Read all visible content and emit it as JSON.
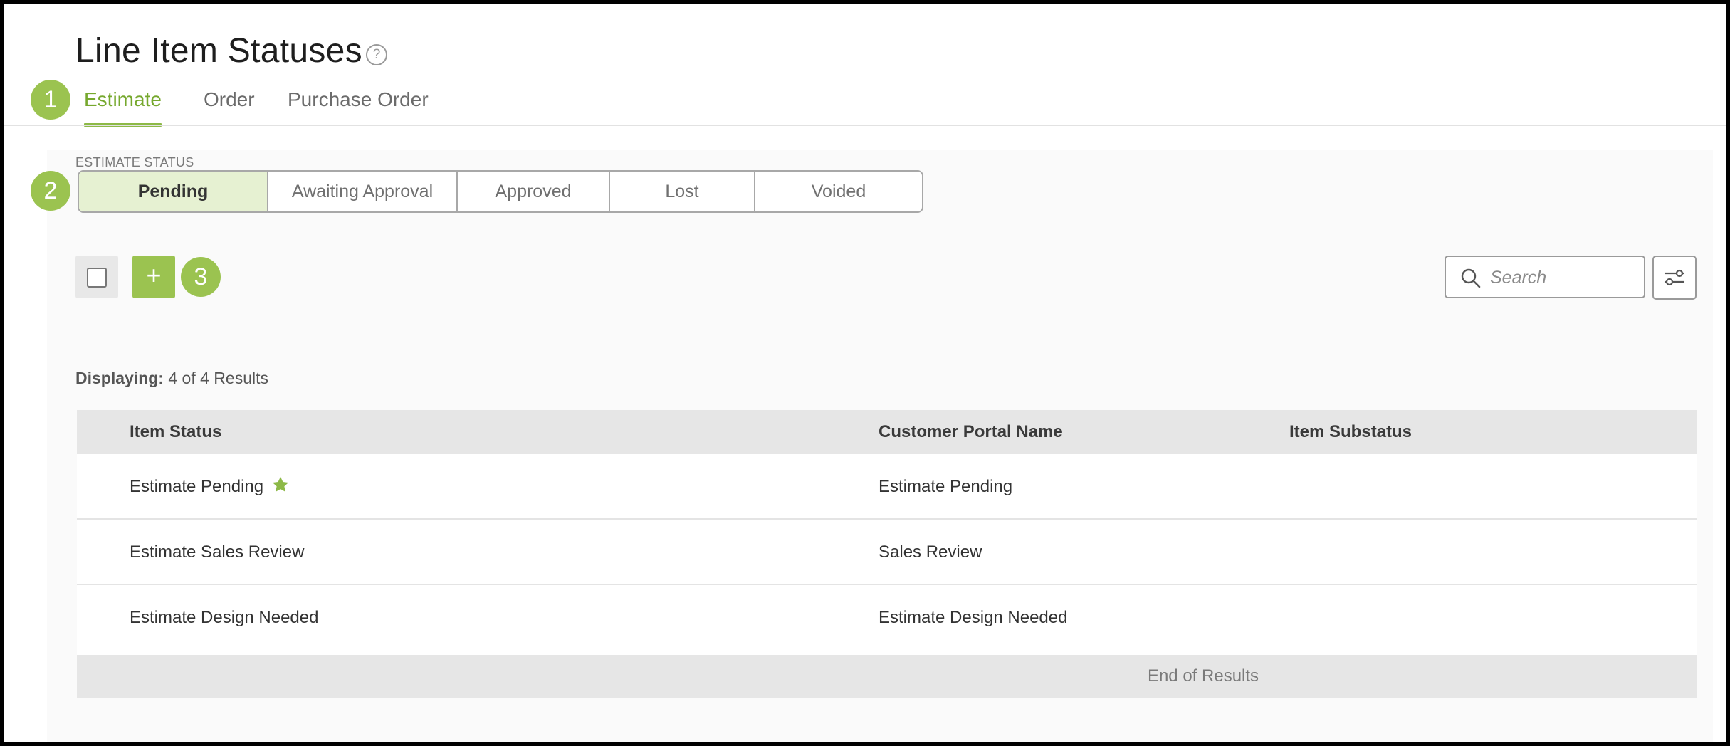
{
  "page": {
    "title": "Line Item Statuses",
    "help_glyph": "?"
  },
  "callouts": [
    "1",
    "2",
    "3"
  ],
  "tabs": [
    {
      "label": "Estimate",
      "active": true
    },
    {
      "label": "Order",
      "active": false
    },
    {
      "label": "Purchase Order",
      "active": false
    }
  ],
  "status_filter": {
    "label": "ESTIMATE STATUS",
    "options": [
      {
        "label": "Pending",
        "active": true
      },
      {
        "label": "Awaiting Approval",
        "active": false
      },
      {
        "label": "Approved",
        "active": false
      },
      {
        "label": "Lost",
        "active": false
      },
      {
        "label": "Voided",
        "active": false
      }
    ]
  },
  "toolbar": {
    "add_label": "+",
    "search_placeholder": "Search"
  },
  "results": {
    "label": "Displaying:",
    "text": "4 of 4 Results"
  },
  "table": {
    "columns": [
      "Item Status",
      "Customer Portal Name",
      "Item Substatus"
    ],
    "rows": [
      {
        "item_status": "Estimate Pending",
        "portal_name": "Estimate Pending",
        "substatus": "",
        "default": true
      },
      {
        "item_status": "Estimate Sales Review",
        "portal_name": "Sales Review",
        "substatus": "",
        "default": false
      },
      {
        "item_status": "Estimate Design Needed",
        "portal_name": "Estimate Design Needed",
        "substatus": "",
        "default": false
      }
    ],
    "end_text": "End of Results"
  },
  "colors": {
    "accent": "#9bc350",
    "accent_text": "#76a82e",
    "active_segment_bg": "#e6f1d2"
  }
}
